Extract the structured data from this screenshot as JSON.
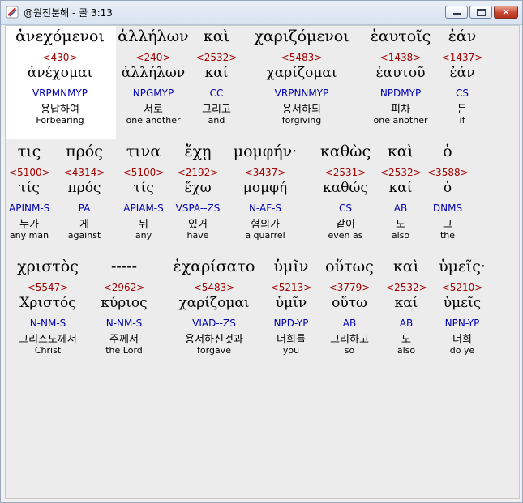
{
  "window": {
    "title": "@원전분해 - 골 3:13",
    "icon": "bible-app-icon"
  },
  "controls": {
    "minimize": "minimize-icon",
    "maximize": "maximize-icon",
    "close_glyph": "✕"
  },
  "rows": [
    [
      {
        "greek": "ἀνεχόμενοι",
        "strong": "<430>",
        "lemma": "ἀνέχομαι",
        "parse": "VRPMNMYP",
        "korean": "용납하여",
        "english": "Forbearing"
      },
      {
        "greek": "ἀλλήλων",
        "strong": "<240>",
        "lemma": "ἀλλήλων",
        "parse": "NPGMYP",
        "korean": "서로",
        "english": "one another"
      },
      {
        "greek": "καὶ",
        "strong": "<2532>",
        "lemma": "καί",
        "parse": "CC",
        "korean": "그리고",
        "english": "and"
      },
      {
        "greek": "χαριζόμενοι",
        "strong": "<5483>",
        "lemma": "χαρίζομαι",
        "parse": "VRPNNMYP",
        "korean": "용서하되",
        "english": "forgiving"
      },
      {
        "greek": "ἑαυτοῖς",
        "strong": "<1438>",
        "lemma": "ἑαυτοῦ",
        "parse": "NPDMYP",
        "korean": "피차",
        "english": "one another"
      },
      {
        "greek": "ἐάν",
        "strong": "<1437>",
        "lemma": "ἐάν",
        "parse": "CS",
        "korean": "든",
        "english": "if"
      }
    ],
    [
      {
        "greek": "τις",
        "strong": "<5100>",
        "lemma": "τίς",
        "parse": "APINM-S",
        "korean": "누가",
        "english": "any man"
      },
      {
        "greek": "πρός",
        "strong": "<4314>",
        "lemma": "πρός",
        "parse": "PA",
        "korean": "게",
        "english": "against"
      },
      {
        "greek": "τινα",
        "strong": "<5100>",
        "lemma": "τίς",
        "parse": "APIAM-S",
        "korean": "뉘",
        "english": "any"
      },
      {
        "greek": "ἔχῃ",
        "strong": "<2192>",
        "lemma": "ἔχω",
        "parse": "VSPA--ZS",
        "korean": "있거",
        "english": "have"
      },
      {
        "greek": "μομφήν·",
        "strong": "<3437>",
        "lemma": "μομφή",
        "parse": "N-AF-S",
        "korean": "혐의가",
        "english": "a quarrel"
      },
      {
        "greek": "καθὼς",
        "strong": "<2531>",
        "lemma": "καθώς",
        "parse": "CS",
        "korean": "같이",
        "english": "even as"
      },
      {
        "greek": "καὶ",
        "strong": "<2532>",
        "lemma": "καί",
        "parse": "AB",
        "korean": "도",
        "english": "also"
      },
      {
        "greek": "ὁ",
        "strong": "<3588>",
        "lemma": "ὁ",
        "parse": "DNMS",
        "korean": "그",
        "english": "the"
      }
    ],
    [
      {
        "greek": "χριστὸς",
        "strong": "<5547>",
        "lemma": "Χριστός",
        "parse": "N-NM-S",
        "korean": "그리스도께서",
        "english": "Christ"
      },
      {
        "greek": "-----",
        "strong": "<2962>",
        "lemma": "κύριος",
        "parse": "N-NM-S",
        "korean": "주께서",
        "english": "the Lord"
      },
      {
        "greek": "ἐχαρίσατο",
        "strong": "<5483>",
        "lemma": "χαρίζομαι",
        "parse": "VIAD--ZS",
        "korean": "용서하신것과",
        "english": "forgave"
      },
      {
        "greek": "ὑμῖν",
        "strong": "<5213>",
        "lemma": "ὑμῖν",
        "parse": "NPD-YP",
        "korean": "너희를",
        "english": "you"
      },
      {
        "greek": "οὕτως",
        "strong": "<3779>",
        "lemma": "οὕτω",
        "parse": "AB",
        "korean": "그리하고",
        "english": "so"
      },
      {
        "greek": "καὶ",
        "strong": "<2532>",
        "lemma": "καί",
        "parse": "AB",
        "korean": "도",
        "english": "also"
      },
      {
        "greek": "ὑμεῖς·",
        "strong": "<5210>",
        "lemma": "ὑμεῖς",
        "parse": "NPN-YP",
        "korean": "너희",
        "english": "do ye"
      }
    ]
  ]
}
